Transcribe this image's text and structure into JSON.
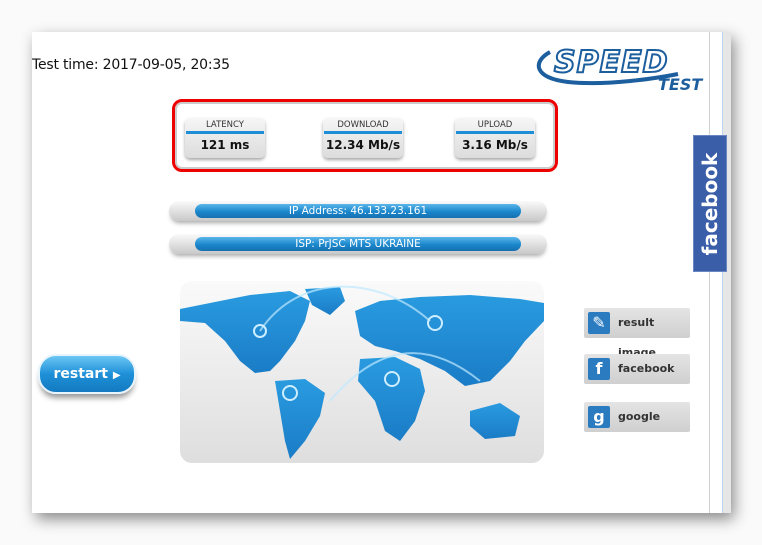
{
  "header": {
    "test_time": "Test time: 2017-09-05, 20:35",
    "logo_top": "SPEED",
    "logo_bottom": "TEST"
  },
  "results": [
    {
      "label": "LATENCY",
      "value": "121 ms"
    },
    {
      "label": "DOWNLOAD",
      "value": "12.34 Mb/s"
    },
    {
      "label": "UPLOAD",
      "value": "3.16 Mb/s"
    }
  ],
  "info": {
    "ip": "IP Address: 46.133.23.161",
    "isp": "ISP: PrJSC MTS UKRAINE"
  },
  "restart_label": "restart",
  "share": [
    {
      "icon": "image-edit-icon",
      "glyph": "✎",
      "label": "result image"
    },
    {
      "icon": "facebook-icon",
      "glyph": "f",
      "label": "facebook"
    },
    {
      "icon": "google-icon",
      "glyph": "g",
      "label": "google"
    }
  ],
  "facebook_tab": "facebook",
  "colors": {
    "accent": "#1e8fd6",
    "highlight": "#ee0000",
    "facebook": "#3b5ea8"
  }
}
